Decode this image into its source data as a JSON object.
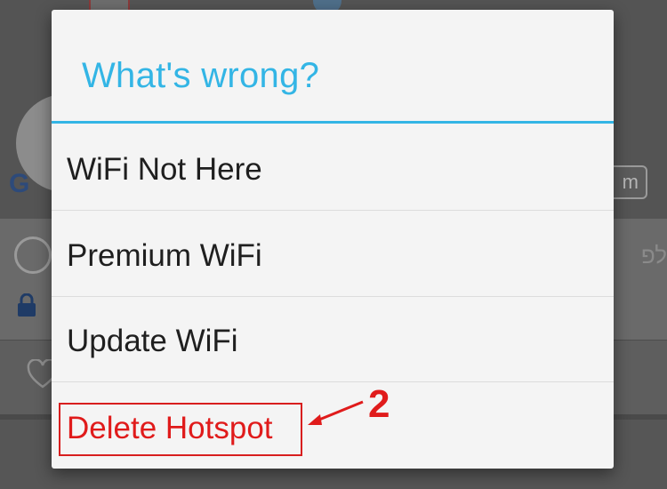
{
  "background": {
    "scale_unit": "m",
    "hebrew_text": "לפ",
    "logo_letters": "G"
  },
  "dialog": {
    "title": "What's wrong?",
    "options": [
      {
        "label": "WiFi Not Here"
      },
      {
        "label": "Premium WiFi"
      },
      {
        "label": "Update WiFi"
      },
      {
        "label": "Delete Hotspot"
      }
    ]
  },
  "annotation": {
    "step_number": "2"
  },
  "colors": {
    "accent": "#33b5e5",
    "annotation_red": "#e01b1b",
    "dialog_bg": "#f4f4f4",
    "scrim": "#5a5a5a"
  }
}
